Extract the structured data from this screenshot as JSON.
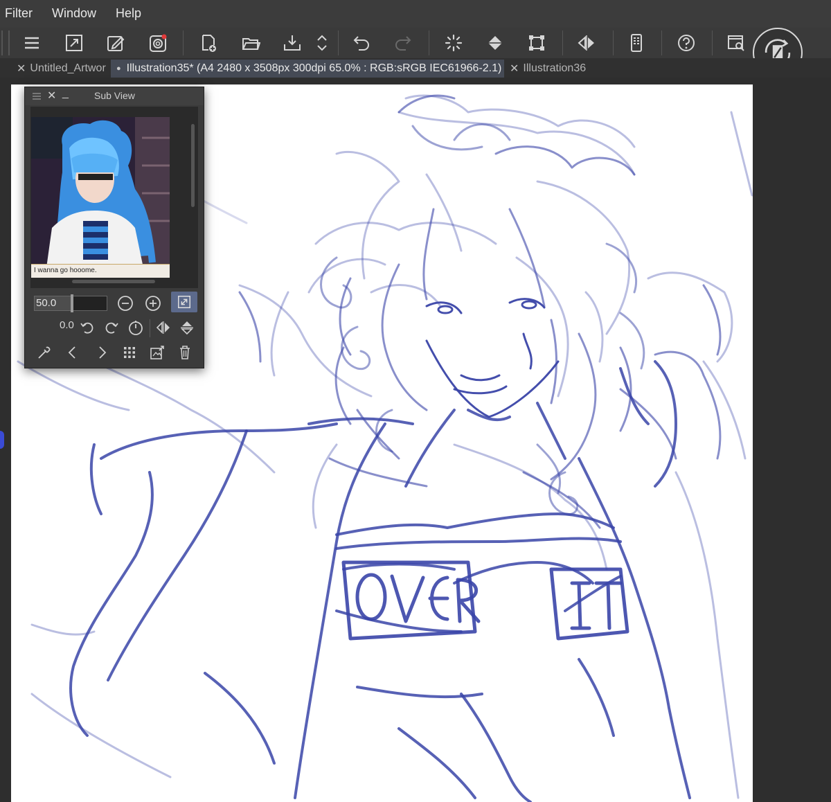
{
  "menu": {
    "items": [
      "Filter",
      "Window",
      "Help"
    ]
  },
  "toolbar": {
    "icons": [
      "menu-icon",
      "fit-screen-icon",
      "edit-icon",
      "record-icon",
      "new-file-icon",
      "open-folder-icon",
      "save-icon",
      "arrow-updown-icon",
      "undo-icon",
      "redo-icon",
      "loading-icon",
      "fill-icon",
      "transform-icon",
      "flip-horizontal-icon",
      "device-icon",
      "help-icon",
      "screen-icon",
      "rotate-view-icon"
    ]
  },
  "tabs": [
    {
      "label": "Untitled_Artwor",
      "active": false
    },
    {
      "label": "Illustration35* (A4 2480 x 3508px 300dpi 65.0% : RGB:sRGB IEC61966-2.1)",
      "active": true
    },
    {
      "label": "Illustration36",
      "active": false
    }
  ],
  "subview": {
    "title": "Sub View",
    "caption": "I wanna go hooome.",
    "zoom": "50.0",
    "rotation": "0.0"
  },
  "colors": {
    "sketch": "#3a45a8",
    "accent": "#5c6a8c"
  }
}
